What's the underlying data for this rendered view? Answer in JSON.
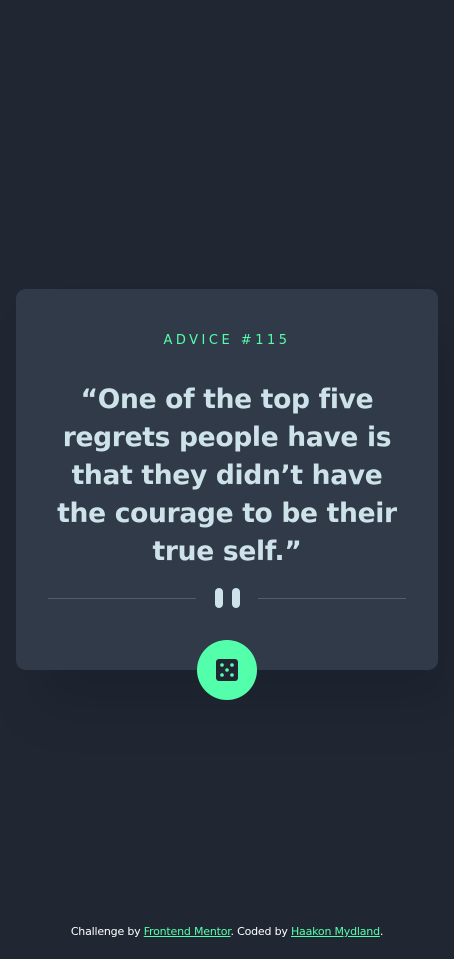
{
  "card": {
    "advice_id": "ADVICE #115",
    "quote": "“One of the top five regrets people have is that they didn’t have the courage to be their true self.”"
  },
  "dice_button": {
    "icon": "dice-icon"
  },
  "divider": {
    "icon": "pause-icon"
  },
  "footer": {
    "prefix": "Challenge by",
    "challenge_link": "Frontend Mentor",
    "middle": ". Coded by",
    "author_link": "Haakon Mydland",
    "suffix": "."
  },
  "colors": {
    "background": "#202733",
    "card": "#313a48",
    "accent": "#53ffaa",
    "text": "#cee3e9",
    "divider": "#4f5d74"
  }
}
